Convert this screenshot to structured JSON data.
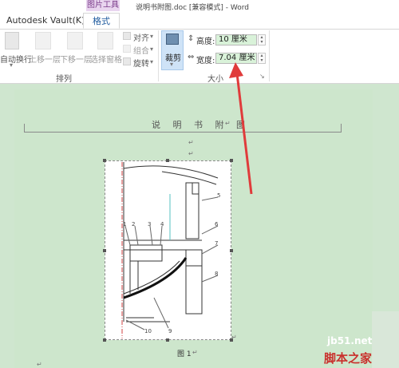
{
  "window": {
    "context_tab_group": "图片工具",
    "doc_title": "说明书附图.doc [兼容模式] - Word"
  },
  "tabs": {
    "vault": "Autodesk Vault(K)",
    "format": "格式"
  },
  "ribbon": {
    "arrange": {
      "wrap_text": "自动换行",
      "bring_forward": "上移一层",
      "send_backward": "下移一层",
      "selection_pane": "选择窗格",
      "align": "对齐",
      "group": "组合",
      "rotate": "旋转",
      "label": "排列"
    },
    "size": {
      "crop": "裁剪",
      "height_label": "高度:",
      "height_value": "10 厘米",
      "width_label": "宽度:",
      "width_value": "7.04 厘米",
      "label": "大小"
    }
  },
  "document": {
    "heading": "说 明 书 附 图",
    "para_mark": "↵",
    "caption": "图 1",
    "drawing_labels": [
      "1",
      "2",
      "3",
      "4",
      "5",
      "6",
      "7",
      "8",
      "9",
      "10"
    ]
  },
  "watermark": {
    "site": "jb51.net",
    "brand": "脚本之家"
  },
  "colors": {
    "ribbon_accent": "#1e5a9e",
    "context_tab": "#e9d5ef",
    "document_bg": "#cfe6cf",
    "input_highlight": "#d9f2d9",
    "arrow": "#e03b3b"
  }
}
